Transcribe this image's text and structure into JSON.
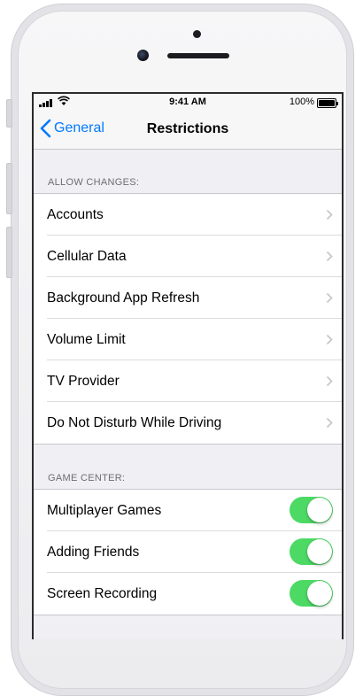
{
  "status_bar": {
    "time": "9:41 AM",
    "battery_percent": "100%",
    "signal_icon": "cellular-signal-icon",
    "wifi_icon": "wifi-icon",
    "battery_icon": "battery-icon"
  },
  "nav": {
    "back_label": "General",
    "title": "Restrictions"
  },
  "allow_changes": {
    "header": "ALLOW CHANGES:",
    "items": [
      {
        "label": "Accounts"
      },
      {
        "label": "Cellular Data"
      },
      {
        "label": "Background App Refresh"
      },
      {
        "label": "Volume Limit"
      },
      {
        "label": "TV Provider"
      },
      {
        "label": "Do Not Disturb While Driving"
      }
    ]
  },
  "game_center": {
    "header": "GAME CENTER:",
    "items": [
      {
        "label": "Multiplayer Games",
        "on": true
      },
      {
        "label": "Adding Friends",
        "on": true
      },
      {
        "label": "Screen Recording",
        "on": true
      }
    ]
  },
  "colors": {
    "accent": "#007aff",
    "toggle_on": "#4cd964",
    "background": "#efeff4"
  }
}
